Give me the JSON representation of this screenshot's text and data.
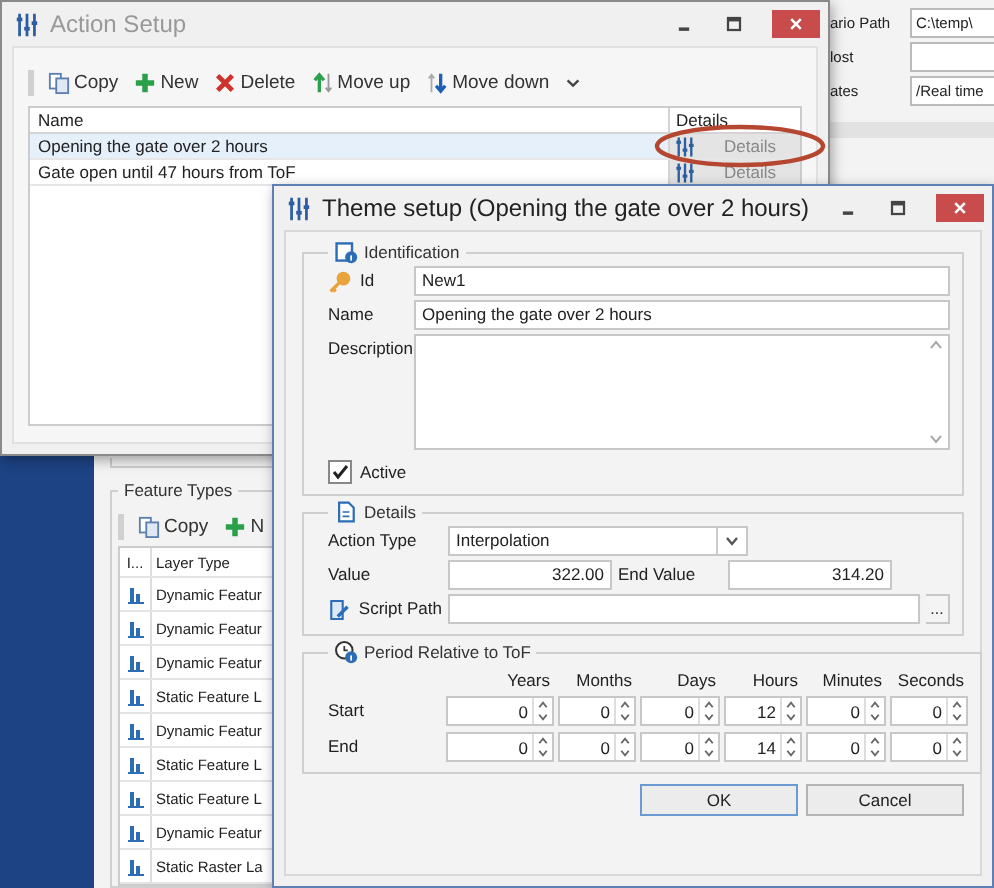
{
  "background_app": {
    "fields": [
      {
        "label": "ario Path",
        "value": "C:\\temp\\"
      },
      {
        "label": "lost"
      },
      {
        "label": "ates",
        "value": "/Real time"
      }
    ],
    "feature_types": {
      "title": "Feature Types",
      "toolbar": [
        {
          "kind": "copy",
          "label": "Copy"
        },
        {
          "kind": "new",
          "label": "N"
        }
      ],
      "columns": [
        "I...",
        "Layer Type"
      ],
      "rows": [
        "Dynamic Featur",
        "Dynamic Featur",
        "Dynamic Featur",
        "Static Feature L",
        "Dynamic Featur",
        "Static Feature L",
        "Static Feature L",
        "Dynamic Featur",
        "Static Raster La"
      ]
    }
  },
  "action_setup": {
    "title": "Action Setup",
    "toolbar": [
      {
        "kind": "copy",
        "label": "Copy"
      },
      {
        "kind": "new",
        "label": "New"
      },
      {
        "kind": "delete",
        "label": "Delete"
      },
      {
        "kind": "move_up",
        "label": "Move up"
      },
      {
        "kind": "move_down",
        "label": "Move down"
      }
    ],
    "columns": [
      "Name",
      "Details"
    ],
    "rows": [
      {
        "name": "Opening the gate over 2 hours",
        "details": "Details",
        "selected": true,
        "highlighted": true
      },
      {
        "name": "Gate open until 47 hours from ToF",
        "details": "Details",
        "selected": false,
        "highlighted": false
      }
    ]
  },
  "theme_setup": {
    "title": "Theme setup (Opening the gate over 2 hours)",
    "identification": {
      "title": "Identification",
      "id_label": "Id",
      "id": "New1",
      "name_label": "Name",
      "name": "Opening the gate over 2 hours",
      "description_label": "Description",
      "active": {
        "label": "Active",
        "checked": true
      }
    },
    "details": {
      "title": "Details",
      "action_type_label": "Action Type",
      "action_type": "Interpolation",
      "value_label": "Value",
      "value": "322.00",
      "end_value_label": "End Value",
      "end_value": "314.20",
      "script_path_label": "Script Path",
      "browse": "..."
    },
    "period": {
      "title": "Period Relative to ToF",
      "columns": [
        "Years",
        "Months",
        "Days",
        "Hours",
        "Minutes",
        "Seconds"
      ],
      "rows": [
        {
          "label": "Start",
          "values": [
            "0",
            "0",
            "0",
            "12",
            "0",
            "0"
          ]
        },
        {
          "label": "End",
          "values": [
            "0",
            "0",
            "0",
            "14",
            "0",
            "0"
          ]
        }
      ]
    },
    "buttons": [
      {
        "label": "OK",
        "default": true
      },
      {
        "label": "Cancel",
        "default": false
      }
    ]
  }
}
